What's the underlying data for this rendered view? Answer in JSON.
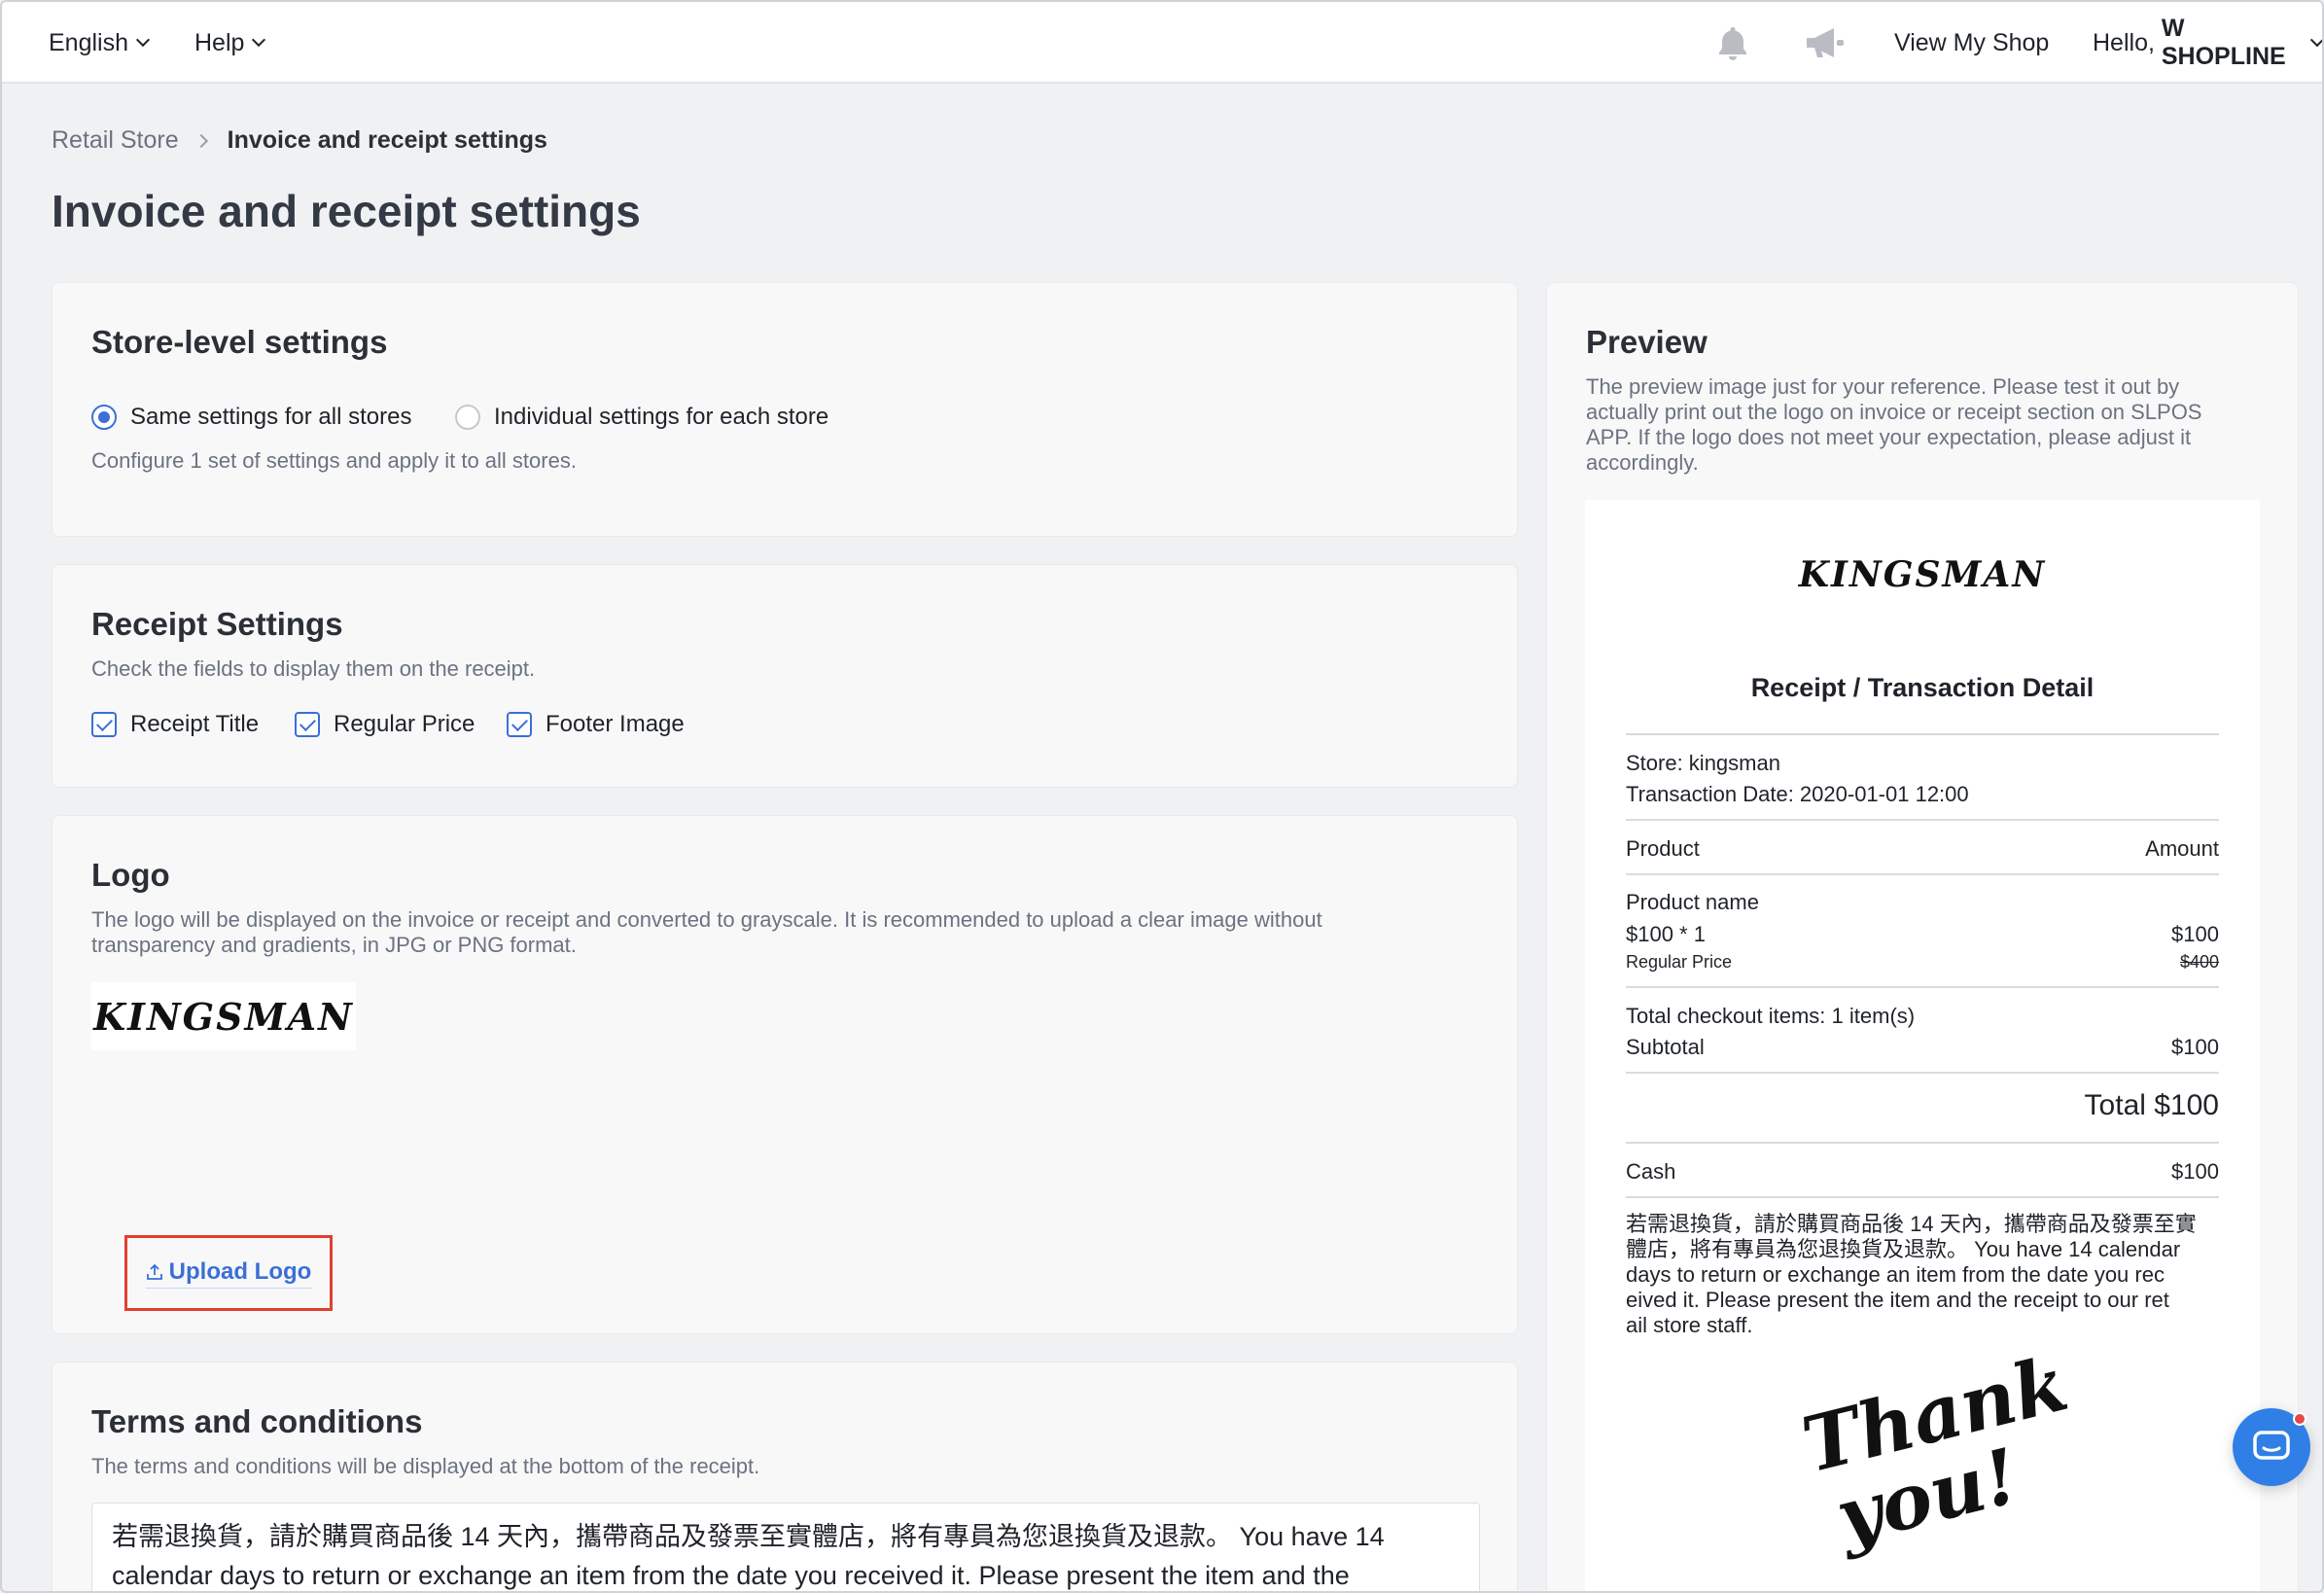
{
  "topbar": {
    "language": "English",
    "help": "Help",
    "view_shop": "View My Shop",
    "greeting_prefix": "Hello, ",
    "account_name": "W SHOPLINE"
  },
  "breadcrumb": {
    "parent": "Retail Store",
    "current": "Invoice and receipt settings"
  },
  "page": {
    "title": "Invoice and receipt settings"
  },
  "store_settings": {
    "title": "Store-level settings",
    "option_all": "Same settings for all stores",
    "option_each": "Individual settings for each store",
    "selected": "option_all",
    "help": "Configure 1 set of settings and apply it to all stores."
  },
  "receipt_settings": {
    "title": "Receipt Settings",
    "help": "Check the fields to display them on the receipt.",
    "fields": [
      {
        "label": "Receipt Title",
        "checked": true
      },
      {
        "label": "Regular Price",
        "checked": true
      },
      {
        "label": "Footer Image",
        "checked": true
      }
    ]
  },
  "logo": {
    "title": "Logo",
    "help_line1": "The logo will be displayed on the invoice or receipt and converted to grayscale. It is recommended to upload a clear image without",
    "help_line2": "transparency and gradients, in JPG or PNG format.",
    "logo_text": "KINGSMAN",
    "upload_label": "Upload Logo"
  },
  "terms": {
    "title": "Terms and conditions",
    "help": "The terms and conditions will be displayed at the bottom of the receipt.",
    "line1": "若需退換貨，請於購買商品後 14 天內，攜帶商品及發票至實體店，將有專員為您退換貨及退款。 You have 14",
    "line2": "calendar days to return or exchange an item from the date you received it. Please present the item and the"
  },
  "preview": {
    "title": "Preview",
    "help_line1": "The preview image just for your reference. Please test it out by",
    "help_line2": "actually print out the logo on invoice or receipt section on SLPOS",
    "help_line3": "APP. If the logo does not meet your expectation, please adjust it",
    "help_line4": "accordingly.",
    "receipt": {
      "logo_text": "KINGSMAN",
      "heading": "Receipt / Transaction Detail",
      "store": "Store: kingsman",
      "date": "Transaction Date: 2020-01-01 12:00",
      "col_product": "Product",
      "col_amount": "Amount",
      "product_name": "Product name",
      "qty_line": "$100 * 1",
      "qty_amount": "$100",
      "regular_label": "Regular Price",
      "regular_amount": "$400",
      "total_items": "Total checkout items: 1 item(s)",
      "subtotal_label": "Subtotal",
      "subtotal_amount": "$100",
      "total": "Total $100",
      "cash_label": "Cash",
      "cash_amount": "$100",
      "terms_line1": "若需退換貨，請於購買商品後 14 天內，攜帶商品及發票至實",
      "terms_line2": "體店，將有專員為您退換貨及退款。 You have 14 calendar",
      "terms_line3": "days to return or exchange an item from the date you rec",
      "terms_line4": "eived it. Please present the item and the receipt to our ret",
      "terms_line5": "ail store staff.",
      "footer_line1": "Thank",
      "footer_line2": "you!"
    }
  },
  "icons": {
    "bell": "bell-icon",
    "announcement": "megaphone-icon",
    "upload": "upload-icon",
    "chat": "chat-icon"
  },
  "colors": {
    "accent": "#3b6fd6",
    "highlight": "#e0402e",
    "chat": "#2f7fe6"
  }
}
